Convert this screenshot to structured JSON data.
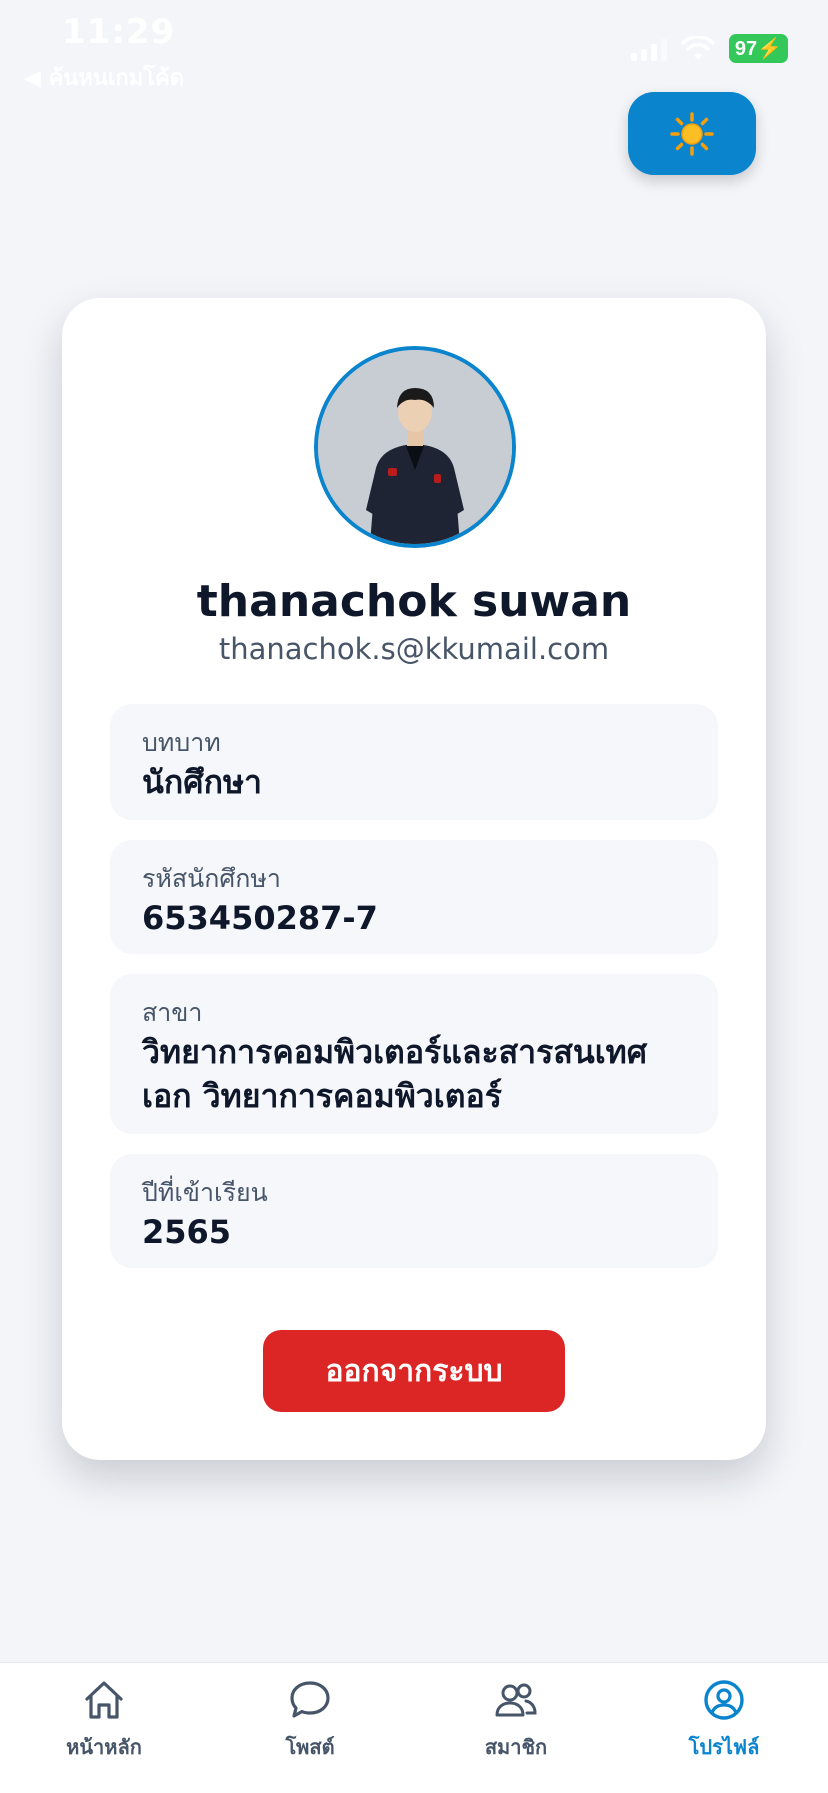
{
  "status_bar": {
    "time": "11:29",
    "back_label": "◀ ค้นหนเกมโค้ด",
    "battery": "97"
  },
  "theme_toggle": {
    "icon": "sun-icon",
    "glyph": "☀️"
  },
  "profile": {
    "name": "thanachok suwan",
    "email": "thanachok.s@kkumail.com",
    "fields": [
      {
        "label": "บทบาท",
        "value": "นักศึกษา"
      },
      {
        "label": "รหัสนักศึกษา",
        "value": "653450287-7"
      },
      {
        "label": "สาขา",
        "value": "วิทยาการคอมพิวเตอร์และสารสนเทศ เอก วิทยาการคอมพิวเตอร์"
      },
      {
        "label": "ปีที่เข้าเรียน",
        "value": "2565"
      }
    ],
    "logout_label": "ออกจากระบบ"
  },
  "bottom_nav": {
    "items": [
      {
        "label": "หน้าหลัก",
        "icon": "home-icon"
      },
      {
        "label": "โพสต์",
        "icon": "chat-bubble-icon"
      },
      {
        "label": "สมาชิก",
        "icon": "users-icon"
      },
      {
        "label": "โปรไฟล์",
        "icon": "profile-icon"
      }
    ],
    "active_index": 3
  },
  "colors": {
    "accent": "#0a84cd",
    "danger": "#dc2626",
    "background": "#f3f5f9",
    "battery": "#34c759"
  }
}
